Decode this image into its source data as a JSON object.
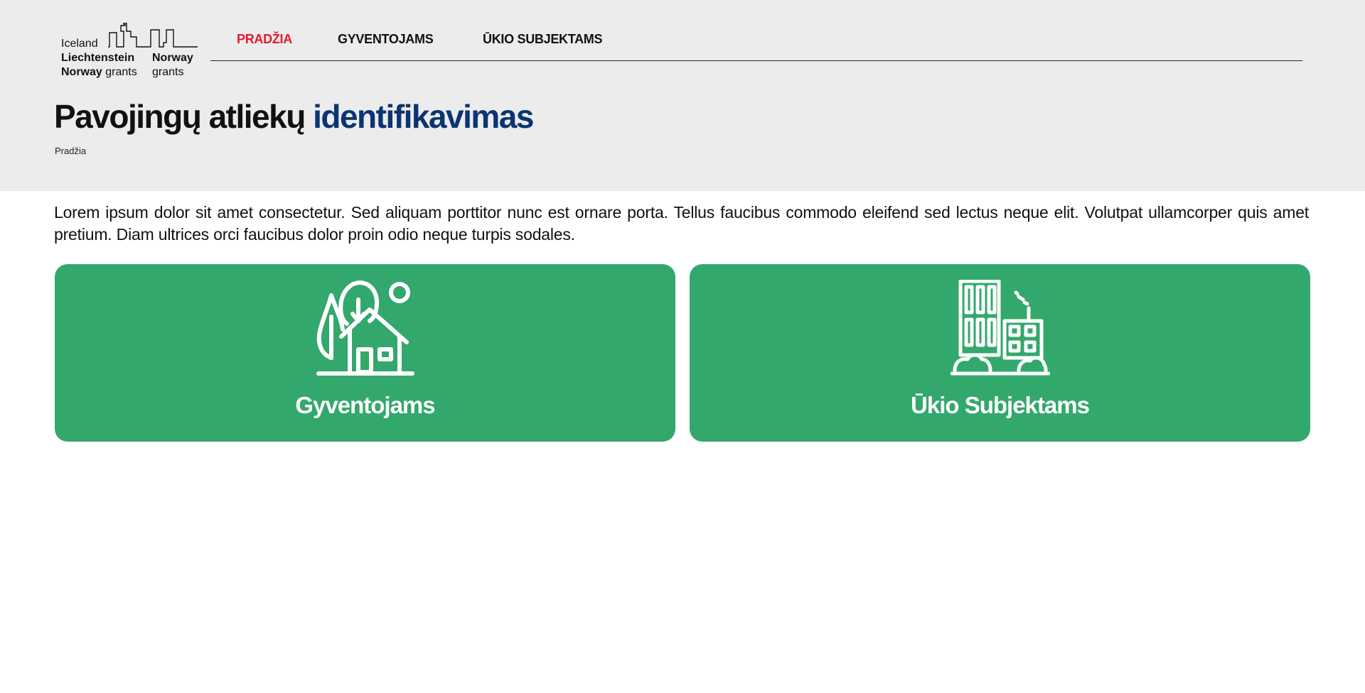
{
  "logo": {
    "line1": "Iceland",
    "line2": "Liechtenstein",
    "line3_bold": "Norway",
    "line3_light": "grants",
    "right1": "Norway",
    "right2": "grants"
  },
  "nav": {
    "items": [
      {
        "label": "PRADŽIA",
        "active": true
      },
      {
        "label": "GYVENTOJAMS",
        "active": false
      },
      {
        "label": "ŪKIO SUBJEKTAMS",
        "active": false
      }
    ]
  },
  "page": {
    "title_main": "Pavojingų atliekų",
    "title_accent": "identifikavimas",
    "breadcrumb": "Pradžia",
    "intro": "Lorem ipsum dolor sit amet consectetur. Sed aliquam porttitor nunc est ornare porta. Tellus faucibus commodo eleifend sed lectus neque elit. Volutpat ullamcorper quis amet pretium. Diam ultrices orci faucibus dolor proin odio neque turpis sodales."
  },
  "cards": [
    {
      "label": "Gyventojams",
      "icon": "house-with-trees-icon"
    },
    {
      "label": "Ūkio Subjektams",
      "icon": "factory-building-icon"
    }
  ],
  "colors": {
    "header_bg": "#ececec",
    "nav_active": "#e41b2b",
    "title_accent": "#0b3572",
    "card_bg": "#33a86c"
  }
}
